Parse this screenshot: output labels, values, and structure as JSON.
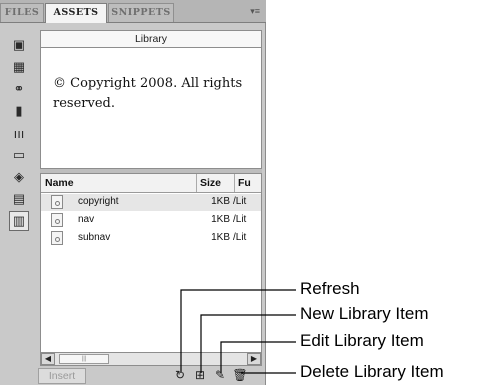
{
  "tabs": [
    {
      "label": "FILES",
      "active": false
    },
    {
      "label": "ASSETS",
      "active": true
    },
    {
      "label": "SNIPPETS",
      "active": false
    }
  ],
  "sidebar": {
    "items": [
      {
        "name": "images-icon"
      },
      {
        "name": "colors-icon"
      },
      {
        "name": "urls-icon"
      },
      {
        "name": "flash-icon"
      },
      {
        "name": "shockwave-icon"
      },
      {
        "name": "movies-icon"
      },
      {
        "name": "scripts-icon"
      },
      {
        "name": "templates-icon"
      },
      {
        "name": "library-icon",
        "active": true
      }
    ]
  },
  "preview": {
    "title": "Library",
    "text": "© Copyright 2008. All rights reserved."
  },
  "table": {
    "columns": [
      "Name",
      "Size",
      "Fu"
    ],
    "rows": [
      {
        "name": "copyright",
        "size": "1KB",
        "path": "/Lit"
      },
      {
        "name": "nav",
        "size": "1KB",
        "path": "/Lit"
      },
      {
        "name": "subnav",
        "size": "1KB",
        "path": "/Lit"
      }
    ]
  },
  "bottom": {
    "insert_label": "Insert"
  },
  "callouts": {
    "refresh": "Refresh",
    "new_item": "New Library Item",
    "edit_item": "Edit Library Item",
    "delete_item": "Delete Library Item"
  }
}
